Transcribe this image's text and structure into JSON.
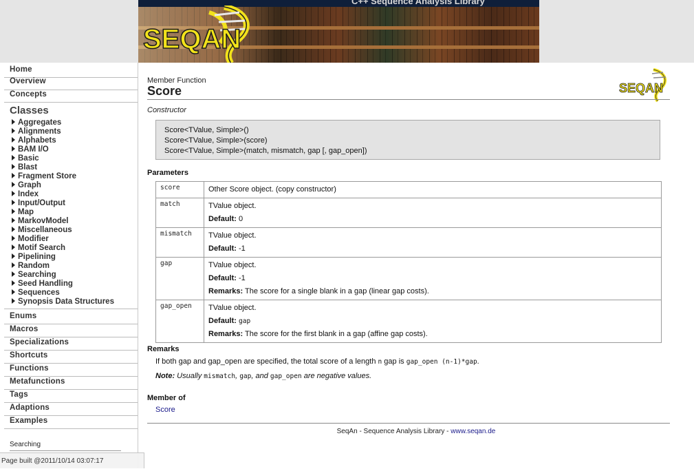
{
  "banner": {
    "site_title": "C++ Sequence Analysis Library",
    "logo_text": "SEQAN",
    "colors": {
      "logo_yellow": "#f2e21b",
      "logo_outline": "#1a1a1a",
      "strip": "#0f1f3a"
    }
  },
  "sidebar": {
    "top_links": [
      "Home",
      "Overview",
      "Concepts"
    ],
    "classes_heading": "Classes",
    "classes": [
      "Aggregates",
      "Alignments",
      "Alphabets",
      "BAM I/O",
      "Basic",
      "Blast",
      "Fragment Store",
      "Graph",
      "Index",
      "Input/Output",
      "Map",
      "MarkovModel",
      "Miscellaneous",
      "Modifier",
      "Motif Search",
      "Pipelining",
      "Random",
      "Searching",
      "Seed Handling",
      "Sequences",
      "Synopsis Data Structures"
    ],
    "bottom_links": [
      "Enums",
      "Macros",
      "Specializations",
      "Shortcuts",
      "Functions",
      "Metafunctions",
      "Tags",
      "Adaptions",
      "Examples"
    ],
    "search_label": "Searching"
  },
  "main": {
    "kind": "Member Function",
    "title": "Score",
    "corner_logo_text": "SEQAN",
    "constructor_label": "Constructor",
    "signatures": [
      "Score<TValue, Simple>()",
      "Score<TValue, Simple>(score)",
      "Score<TValue, Simple>(match, mismatch, gap [, gap_open])"
    ],
    "parameters_heading": "Parameters",
    "default_label": "Default:",
    "remarks_label": "Remarks:",
    "parameters": [
      {
        "name": "score",
        "desc": "Other Score object. (copy constructor)"
      },
      {
        "name": "match",
        "desc": "TValue object.",
        "default": "0"
      },
      {
        "name": "mismatch",
        "desc": "TValue object.",
        "default": "-1"
      },
      {
        "name": "gap",
        "desc": "TValue object.",
        "default": "-1",
        "remarks": "The score for a single blank in a gap (linear gap costs)."
      },
      {
        "name": "gap_open",
        "desc": "TValue object.",
        "default": "gap",
        "remarks": "The score for the first blank in a gap (affine gap costs)."
      }
    ],
    "remarks_heading": "Remarks",
    "remarks": {
      "part1": "If both gap and gap_open are specified, the total score of a length ",
      "code1": "n",
      "part2": " gap is ",
      "code2": "gap_open (n-1)*gap",
      "part3": "."
    },
    "note": {
      "label": "Note:",
      "t1": " Usually ",
      "c1": "mismatch",
      "t2": ", ",
      "c2": "gap",
      "t3": ", and ",
      "c3": "gap_open",
      "t4": " are negative values."
    },
    "member_of_heading": "Member of",
    "member_of_link": "Score",
    "footer": {
      "text": "SeqAn - Sequence Analysis Library - ",
      "link": "www.seqan.de"
    }
  },
  "status_bar": "Page built @2011/10/14 03:07:17"
}
